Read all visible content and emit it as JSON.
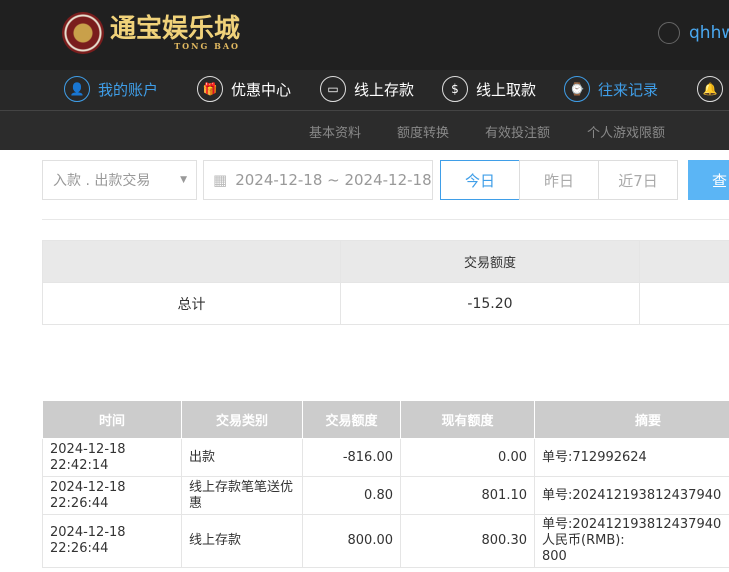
{
  "header": {
    "logo_text": "通宝娱乐城",
    "logo_sub": "TONG BAO",
    "logo_chip": "TB",
    "username": "qhhw"
  },
  "nav": [
    {
      "label": "我的账户",
      "icon": "user-icon",
      "active": true
    },
    {
      "label": "优惠中心",
      "icon": "gift-icon"
    },
    {
      "label": "线上存款",
      "icon": "deposit-icon"
    },
    {
      "label": "线上取款",
      "icon": "withdraw-icon"
    },
    {
      "label": "往来记录",
      "icon": "records-icon",
      "active": true
    },
    {
      "label": "",
      "icon": "bell-icon"
    }
  ],
  "subnav": [
    "基本资料",
    "额度转换",
    "有效投注额",
    "个人游戏限额"
  ],
  "filters": {
    "type": "入款 . 出款交易",
    "date_range": "2024-12-18 ~ 2024-12-18",
    "today": "今日",
    "yesterday": "昨日",
    "last7": "近7日",
    "search": "查"
  },
  "summary": {
    "header": "交易额度",
    "label": "总计",
    "amount": "-15.20"
  },
  "table": {
    "columns": [
      "时间",
      "交易类别",
      "交易额度",
      "现有额度",
      "摘要"
    ],
    "rows": [
      {
        "time": "2024-12-18 22:42:14",
        "type": "出款",
        "amount": "-816.00",
        "balance": "0.00",
        "note": [
          "单号:712992624"
        ]
      },
      {
        "time": "2024-12-18 22:26:44",
        "type": "线上存款笔笔送优惠",
        "amount": "0.80",
        "balance": "801.10",
        "note": [
          "单号:202412193812437940"
        ]
      },
      {
        "time": "2024-12-18 22:26:44",
        "type": "线上存款",
        "amount": "800.00",
        "balance": "800.30",
        "note": [
          "单号:202412193812437940",
          "人民币(RMB):",
          "800"
        ]
      }
    ]
  },
  "colors": {
    "accent": "#3f9ee8",
    "search_button": "#5bb5f5"
  }
}
